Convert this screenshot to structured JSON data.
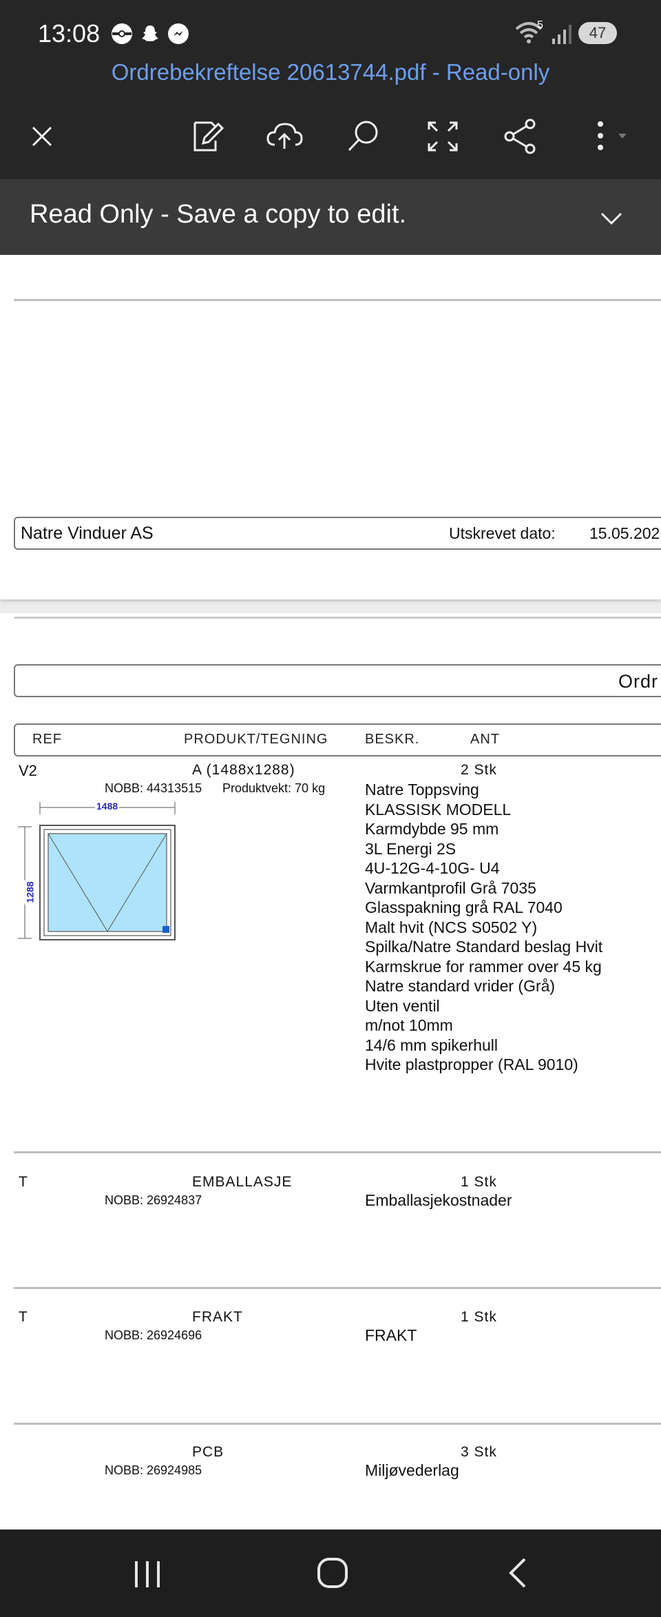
{
  "status_bar": {
    "time": "13:08",
    "notification_icons": [
      "pokemon-go-icon",
      "snapchat-icon",
      "messenger-icon"
    ],
    "wifi_badge": "5",
    "battery": "47"
  },
  "app_bar": {
    "title": "Ordrebekreftelse 20613744.pdf - Read-only",
    "actions": [
      "close-icon",
      "edit-icon",
      "cloud-upload-icon",
      "search-icon",
      "fullscreen-icon",
      "share-icon",
      "more-icon"
    ]
  },
  "banner": {
    "text": "Read Only - Save a copy to edit."
  },
  "page1": {
    "company": "Natre Vinduer AS",
    "date_label": "Utskrevet dato:",
    "date_value": "15.05.202"
  },
  "page2": {
    "order_label": "Ordr",
    "headers": {
      "ref": "REF",
      "product": "PRODUKT/TEGNING",
      "description": "BESKR.",
      "quantity": "ANT"
    },
    "items": [
      {
        "ref": "V2",
        "product": "A (1488x1288)",
        "nobb": "NOBB: 44313515",
        "weight": "Produktvekt: 70 kg",
        "quantity": "2 Stk",
        "drawing": {
          "width_label": "1488",
          "height_label": "1288"
        },
        "description": [
          "Natre Toppsving",
          "KLASSISK MODELL",
          "Karmdybde 95 mm",
          "3L Energi 2S",
          "4U-12G-4-10G- U4",
          "Varmkantprofil Grå 7035",
          "Glasspakning grå RAL 7040",
          "Malt hvit (NCS S0502 Y)",
          "Spilka/Natre Standard beslag Hvit",
          "Karmskrue for rammer over 45 kg",
          "Natre standard vrider (Grå)",
          "Uten ventil",
          "m/not 10mm",
          "14/6 mm spikerhull",
          "Hvite plastpropper (RAL 9010)"
        ]
      },
      {
        "ref": "T",
        "product": "EMBALLASJE",
        "nobb": "NOBB: 26924837",
        "quantity": "1 Stk",
        "description": [
          "Emballasjekostnader"
        ]
      },
      {
        "ref": "T",
        "product": "FRAKT",
        "nobb": "NOBB: 26924696",
        "quantity": "1 Stk",
        "description": [
          "FRAKT"
        ]
      },
      {
        "ref": "",
        "product": "PCB",
        "nobb": "NOBB: 26924985",
        "quantity": "3 Stk",
        "description": [
          "Miljøvederlag"
        ]
      }
    ]
  },
  "nav_bar": {
    "buttons": [
      "recent-apps-icon",
      "home-icon",
      "back-icon"
    ]
  },
  "colors": {
    "app_bar_bg": "#262626",
    "title_link": "#6d9eeb",
    "banner_bg": "#3a3a3a",
    "drawing_glass": "#aee3fb",
    "drawing_dimension": "#2b2bb0"
  }
}
